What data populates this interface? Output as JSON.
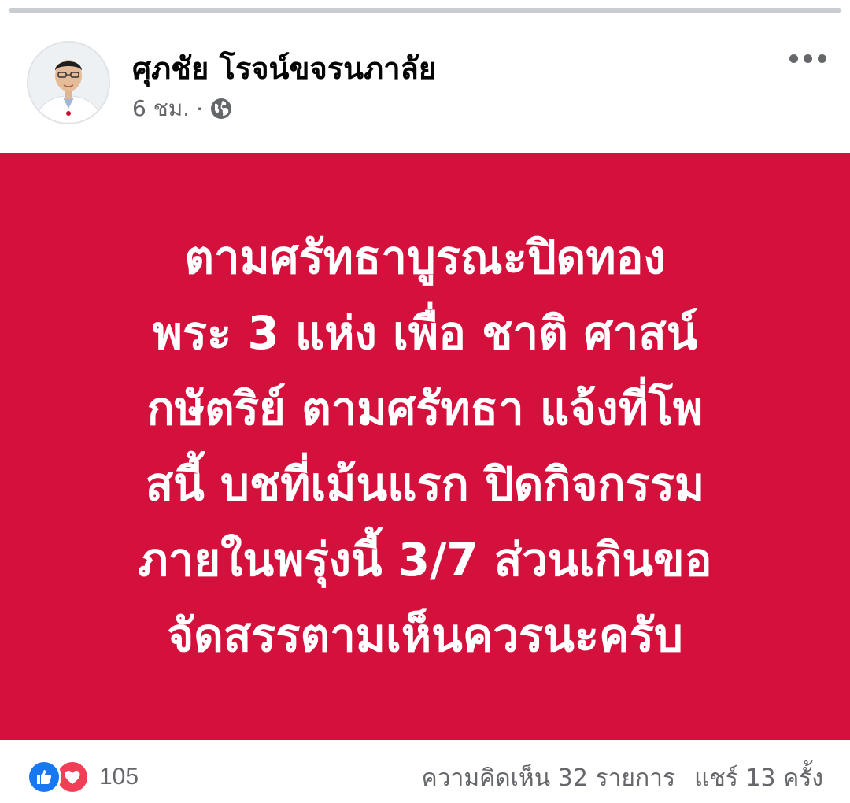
{
  "post": {
    "author": {
      "name": "ศุภชัย โรจน์ขจรนภาลัย",
      "avatar_icon": "person-avatar"
    },
    "time": "6 ชม.",
    "separator": "·",
    "audience_icon": "globe-icon",
    "more_icon": "more-horizontal-icon",
    "background_color": "#d3113c",
    "text_lines": [
      "ตามศรัทธาบูรณะปิดทอง",
      "พระ 3 แห่ง เพื่อ ชาติ ศาสน์",
      "กษัตริย์ ตามศรัทธา แจ้งที่โพ",
      "สนี้ บชที่เม้นแรก ปิดกิจกรรม",
      "ภายในพรุ่งนี้ 3/7 ส่วนเกินขอ",
      "จัดสรรตามเห็นควรนะครับ"
    ]
  },
  "footer": {
    "reaction_icons": [
      "like-icon",
      "love-icon"
    ],
    "reaction_count": "105",
    "comments": "ความคิดเห็น 32 รายการ",
    "shares": "แชร์ 13 ครั้ง"
  },
  "colors": {
    "like": "#1877f2",
    "love": "#f33e58",
    "meta_text": "#65676b"
  }
}
